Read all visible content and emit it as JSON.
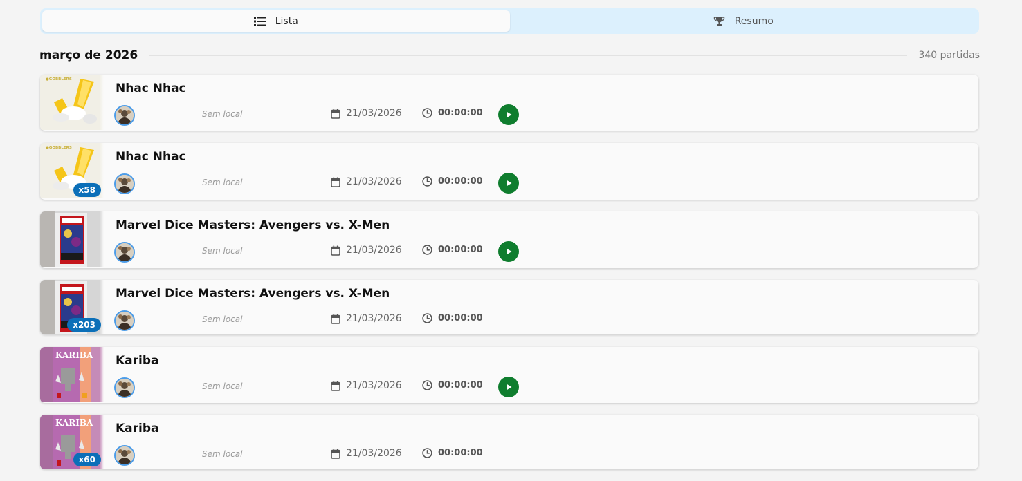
{
  "tabs": [
    {
      "label": "Lista",
      "icon": "list-icon",
      "active": true
    },
    {
      "label": "Resumo",
      "icon": "trophy-icon",
      "active": false
    }
  ],
  "month": {
    "title": "março de 2026",
    "count": "340 partidas"
  },
  "colors": {
    "accent": "#0b6fb8",
    "play": "#0f7d2e",
    "tab_bg": "#dcf0fd"
  },
  "plays": [
    {
      "title": "Nhac Nhac",
      "thumb": "gobblers",
      "badge": "",
      "location": "Sem local",
      "date": "21/03/2026",
      "duration": "00:00:00",
      "has_play": true
    },
    {
      "title": "Nhac Nhac",
      "thumb": "gobblers",
      "badge": "x58",
      "location": "Sem local",
      "date": "21/03/2026",
      "duration": "00:00:00",
      "has_play": true
    },
    {
      "title": "Marvel Dice Masters: Avengers vs. X-Men",
      "thumb": "marvel",
      "badge": "",
      "location": "Sem local",
      "date": "21/03/2026",
      "duration": "00:00:00",
      "has_play": true
    },
    {
      "title": "Marvel Dice Masters: Avengers vs. X-Men",
      "thumb": "marvel",
      "badge": "x203",
      "location": "Sem local",
      "date": "21/03/2026",
      "duration": "00:00:00",
      "has_play": false
    },
    {
      "title": "Kariba",
      "thumb": "kariba",
      "badge": "",
      "location": "Sem local",
      "date": "21/03/2026",
      "duration": "00:00:00",
      "has_play": true
    },
    {
      "title": "Kariba",
      "thumb": "kariba",
      "badge": "x60",
      "location": "Sem local",
      "date": "21/03/2026",
      "duration": "00:00:00",
      "has_play": false
    }
  ]
}
